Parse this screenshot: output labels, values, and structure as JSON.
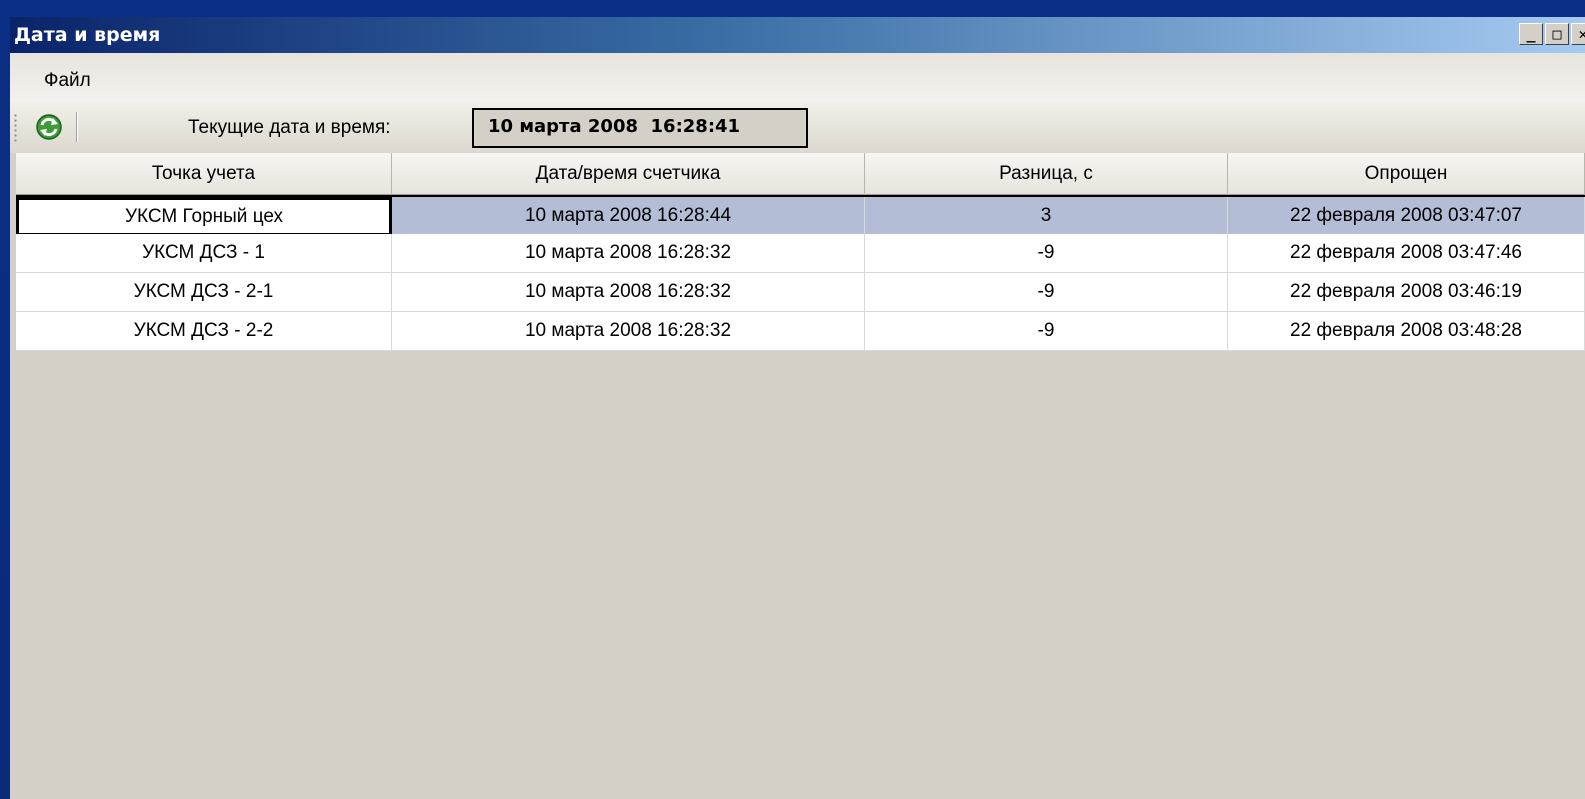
{
  "window": {
    "title": "Дата и время",
    "controls": {
      "minimize": "_",
      "maximize": "□",
      "close": "✕"
    }
  },
  "menu": {
    "items": [
      {
        "label": "Файл"
      }
    ]
  },
  "toolbar": {
    "refresh_icon": "refresh-icon",
    "current_label": "Текущие дата и время:",
    "current_value": "10 марта 2008  16:28:41"
  },
  "table": {
    "columns": [
      "Точка учета",
      "Дата/время счетчика",
      "Разница, с",
      "Опрощен"
    ],
    "rows": [
      {
        "point": "УКСМ Горный цех",
        "meter_time": "10 марта 2008 16:28:44",
        "diff": "3",
        "polled": "22 февраля 2008 03:47:07",
        "selected": true
      },
      {
        "point": "УКСМ ДСЗ - 1",
        "meter_time": "10 марта 2008 16:28:32",
        "diff": "-9",
        "polled": "22 февраля 2008 03:47:46",
        "selected": false
      },
      {
        "point": "УКСМ ДСЗ - 2-1",
        "meter_time": "10 марта 2008 16:28:32",
        "diff": "-9",
        "polled": "22 февраля 2008 03:46:19",
        "selected": false
      },
      {
        "point": "УКСМ ДСЗ - 2-2",
        "meter_time": "10 марта 2008 16:28:32",
        "diff": "-9",
        "polled": "22 февраля 2008 03:48:28",
        "selected": false
      }
    ]
  },
  "colors": {
    "desktop": "#0a2b7e",
    "title_gradient_start": "#0a246a",
    "title_gradient_end": "#a6caf0",
    "selection": "#b3bdd6",
    "window_bg": "#d4d0c8"
  }
}
